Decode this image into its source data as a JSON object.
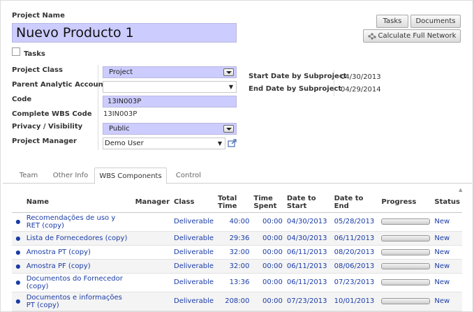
{
  "header": {
    "project_name_label": "Project Name",
    "project_name_value": "Nuevo Producto 1",
    "tasks_checkbox_label": "Tasks"
  },
  "buttons": {
    "tasks": "Tasks",
    "documents": "Documents",
    "calculate": "Calculate Full Network"
  },
  "form": {
    "project_class": {
      "label": "Project Class",
      "value": "Project"
    },
    "parent_account": {
      "label": "Parent Analytic Account",
      "value": ""
    },
    "code": {
      "label": "Code",
      "value": "13IN003P"
    },
    "complete_wbs": {
      "label": "Complete WBS Code",
      "value": "13IN003P"
    },
    "privacy": {
      "label": "Privacy / Visibility",
      "value": "Public"
    },
    "manager": {
      "label": "Project Manager",
      "value": "Demo User"
    },
    "start_date": {
      "label": "Start Date by Subproject",
      "value": "04/30/2013"
    },
    "end_date": {
      "label": "End Date by Subproject",
      "value": "04/29/2014"
    }
  },
  "tabs": [
    {
      "label": "Team"
    },
    {
      "label": "Other Info"
    },
    {
      "label": "WBS Components",
      "active": true
    },
    {
      "label": "Control"
    }
  ],
  "table": {
    "headers": {
      "name": "Name",
      "manager": "Manager",
      "class": "Class",
      "total_time": "Total Time",
      "time_spent": "Time Spent",
      "date_start": "Date to Start",
      "date_end": "Date to End",
      "progress": "Progress",
      "status": "Status"
    },
    "rows": [
      {
        "name": "Recomendações de uso y RET (copy)",
        "manager": "",
        "class": "Deliverable",
        "total": "40:00",
        "spent": "00:00",
        "start": "04/30/2013",
        "end": "05/28/2013",
        "progress": 0,
        "status": "New"
      },
      {
        "name": "Lista de Fornecedores (copy)",
        "manager": "",
        "class": "Deliverable",
        "total": "29:36",
        "spent": "00:00",
        "start": "04/30/2013",
        "end": "06/11/2013",
        "progress": 0,
        "status": "New"
      },
      {
        "name": "Amostra PT (copy)",
        "manager": "",
        "class": "Deliverable",
        "total": "32:00",
        "spent": "00:00",
        "start": "06/11/2013",
        "end": "08/20/2013",
        "progress": 0,
        "status": "New"
      },
      {
        "name": "Amostra PF (copy)",
        "manager": "",
        "class": "Deliverable",
        "total": "32:00",
        "spent": "00:00",
        "start": "06/11/2013",
        "end": "08/06/2013",
        "progress": 0,
        "status": "New"
      },
      {
        "name": "Documentos do Fornecedor (copy)",
        "manager": "",
        "class": "Deliverable",
        "total": "13:36",
        "spent": "00:00",
        "start": "06/11/2013",
        "end": "07/23/2013",
        "progress": 0,
        "status": "New"
      },
      {
        "name": "Documentos e informações PT (copy)",
        "manager": "",
        "class": "Deliverable",
        "total": "208:00",
        "spent": "00:00",
        "start": "07/23/2013",
        "end": "10/01/2013",
        "progress": 0,
        "status": "New"
      }
    ]
  }
}
